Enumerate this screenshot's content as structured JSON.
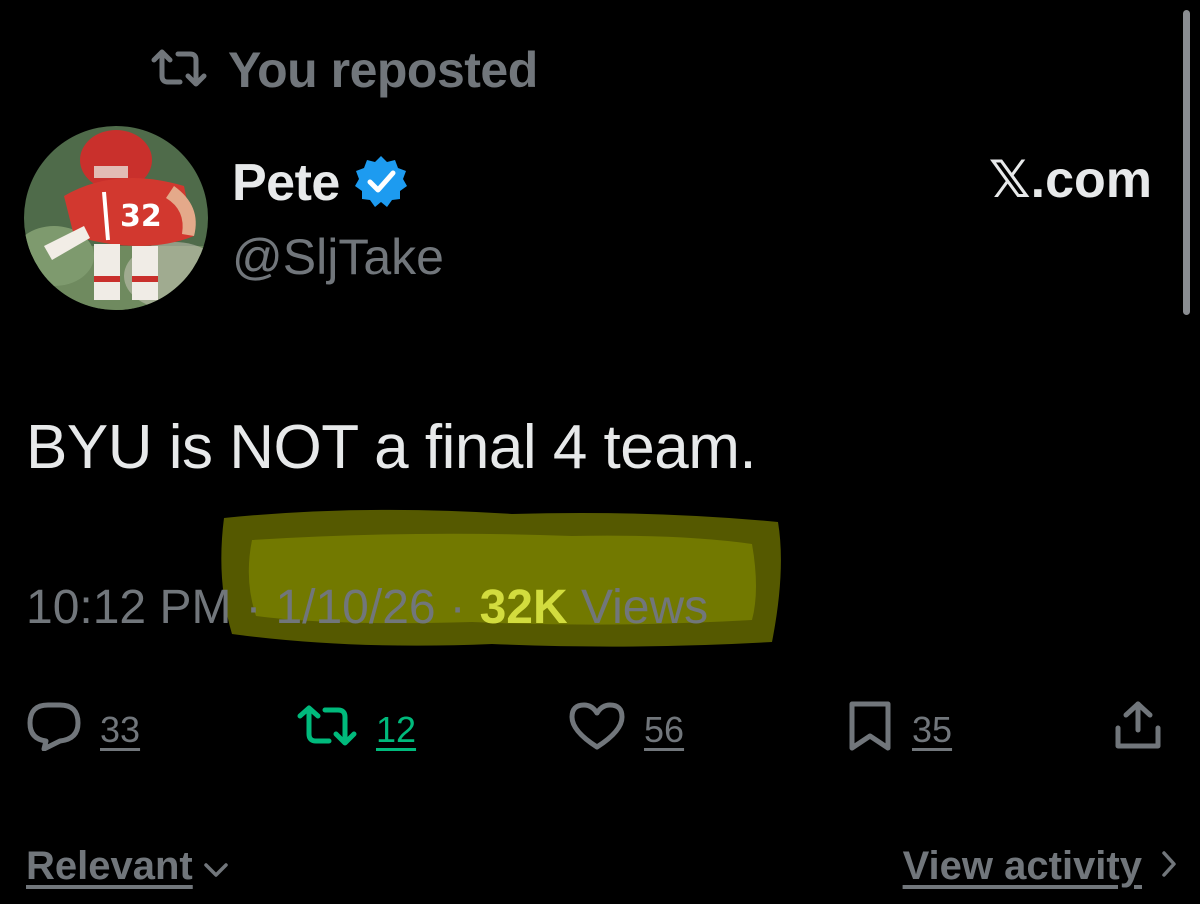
{
  "repost_header": {
    "text": "You reposted",
    "icon": "repost-icon"
  },
  "author": {
    "display_name": "Pete",
    "handle": "@SljTake",
    "verified": true,
    "verified_color": "#1d9bf0",
    "jersey_number": "32"
  },
  "source": "𝕏.com",
  "tweet": {
    "text": "BYU is NOT a final 4 team.",
    "time": "10:12 PM",
    "date": "1/10/26",
    "views_count": "32K",
    "views_label": "Views",
    "highlight_color": "#c8d400"
  },
  "actions": {
    "replies": "33",
    "reposts": "12",
    "likes": "56",
    "bookmarks": "35",
    "repost_active_color": "#00ba7c"
  },
  "footer": {
    "relevant_label": "Relevant",
    "view_activity_label": "View activity"
  },
  "colors": {
    "background": "#000000",
    "primary_text": "#e7e9ea",
    "secondary_text": "#71767b"
  }
}
